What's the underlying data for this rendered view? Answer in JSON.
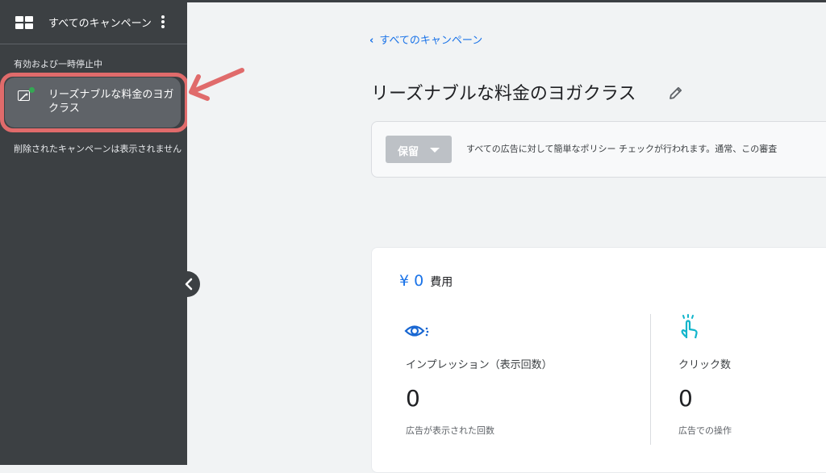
{
  "sidebar": {
    "header_title": "すべてのキャンペーン",
    "section_label": "有効および一時停止中",
    "campaign_item": {
      "label": "リーズナブルな料金のヨガクラス",
      "status_color": "#34a853"
    },
    "deleted_note": "削除されたキャンペーンは表示されません"
  },
  "main": {
    "back_link": "すべてのキャンペーン",
    "campaign_title": "リーズナブルな料金のヨガクラス",
    "notice": {
      "status_button": "保留",
      "text": "すべての広告に対して簡単なポリシー チェックが行われます。通常、この審査"
    },
    "summary": {
      "cost_value": "¥ 0",
      "cost_label": "費用",
      "impressions": {
        "label": "インプレッション（表示回数）",
        "value": "0",
        "sublabel": "広告が表示された回数"
      },
      "clicks": {
        "label": "クリック数",
        "value": "0",
        "sublabel": "広告での操作"
      }
    }
  },
  "colors": {
    "accent": "#1a73e8",
    "highlight": "#e06b6b",
    "sidebar": "#3c4043",
    "active_item": "#5f6368"
  }
}
